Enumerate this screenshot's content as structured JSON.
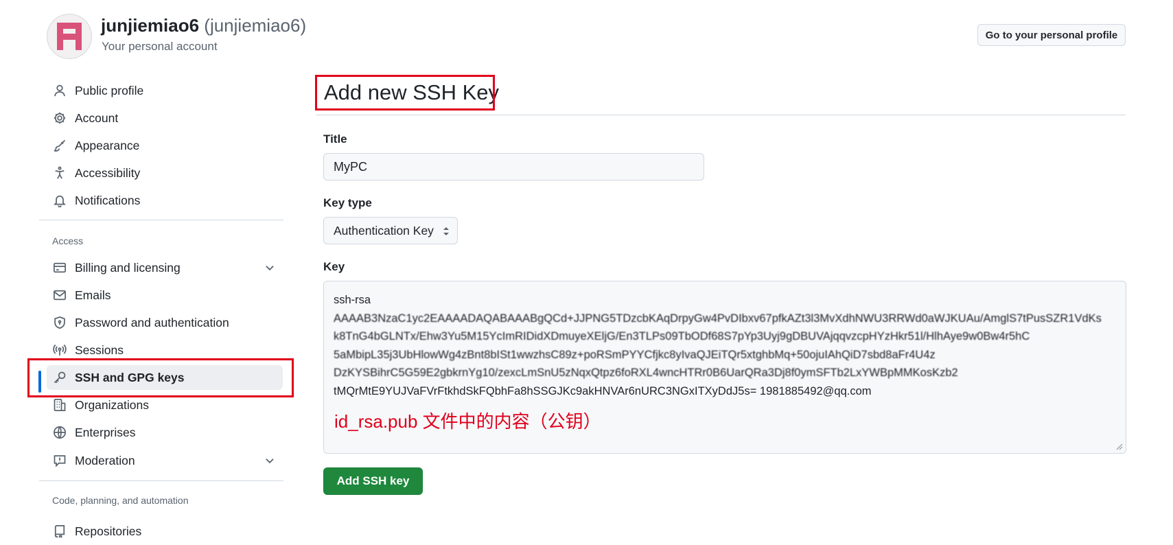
{
  "header": {
    "display_name": "junjiemiao6",
    "login": "(junjiemiao6)",
    "subtitle": "Your personal account",
    "profile_button": "Go to your personal profile"
  },
  "sidebar": {
    "items_top": [
      {
        "label": "Public profile",
        "icon": "person-icon"
      },
      {
        "label": "Account",
        "icon": "gear-icon"
      },
      {
        "label": "Appearance",
        "icon": "paintbrush-icon"
      },
      {
        "label": "Accessibility",
        "icon": "accessibility-icon"
      },
      {
        "label": "Notifications",
        "icon": "bell-icon"
      }
    ],
    "section_access": "Access",
    "items_access": [
      {
        "label": "Billing and licensing",
        "icon": "credit-card-icon",
        "expandable": true
      },
      {
        "label": "Emails",
        "icon": "mail-icon"
      },
      {
        "label": "Password and authentication",
        "icon": "shield-lock-icon"
      },
      {
        "label": "Sessions",
        "icon": "broadcast-icon"
      },
      {
        "label": "SSH and GPG keys",
        "icon": "key-icon",
        "active": true
      },
      {
        "label": "Organizations",
        "icon": "organization-icon"
      },
      {
        "label": "Enterprises",
        "icon": "globe-icon"
      },
      {
        "label": "Moderation",
        "icon": "report-icon",
        "expandable": true
      }
    ],
    "section_code": "Code, planning, and automation",
    "items_code": [
      {
        "label": "Repositories",
        "icon": "repo-icon"
      }
    ]
  },
  "main": {
    "title": "Add new SSH Key",
    "title_label": "Title",
    "title_value": "MyPC",
    "key_type_label": "Key type",
    "key_type_value": "Authentication Key",
    "key_label": "Key",
    "key_lines": [
      "ssh-rsa",
      "AAAAB3NzaC1yc2EAAAADAQABAAABgQCd+JJPNG5TDzcbKAqDrpyGw4PvDIbxv67pfkAZt3l3MvXdhNWU3RRWd0aWJKUAu/AmglS7tPusSZR1VdKs",
      "k8TnG4bGLNTx/Ehw3Yu5M15YcImRIDidXDmuyeXEljG/En3TLPs09TbODf68S7pYp3Uyj9gDBUVAjqqvzcpHYzHkr51l/HlhAye9w0Bw4r5hC",
      "5aMbipL35j3UbHlowWg4zBnt8bISt1wwzhsC89z+poRSmPYYCfjkc8yIvaQJEiTQr5xtghbMq+50ojuIAhQiD7sbd8aFr4U4z",
      "DzKYSBihrC5G59E2gbkrnYg10/zexcLmSnU5zNqxQtpz6foRXL4wncHTRr0B6UarQRa3Dj8f0ymSFTb2LxYWBpMMKosKzb2",
      "tMQrMtE9YUJVaFVrFtkhdSkFQbhFa8hSSGJKc9akHNVAr6nURC3NGxITXyDdJ5s= 1981885492@qq.com"
    ],
    "key_annotation": "id_rsa.pub 文件中的内容（公钥）",
    "submit_label": "Add SSH key"
  },
  "colors": {
    "accent": "#0969da",
    "primary_button": "#1f883d",
    "highlight_box": "#e0001b"
  }
}
